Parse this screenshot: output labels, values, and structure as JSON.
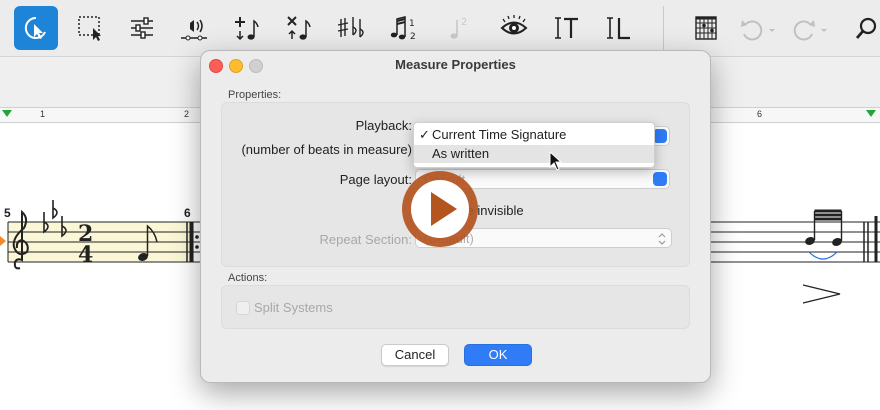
{
  "toolbar": {
    "tools": [
      {
        "name": "selection-arrow-icon"
      },
      {
        "name": "select-region-icon"
      },
      {
        "name": "mixer-sliders-icon"
      },
      {
        "name": "playback-speaker-icon"
      },
      {
        "name": "add-note-icon"
      },
      {
        "name": "delete-note-icon"
      },
      {
        "name": "accidentals-icon"
      },
      {
        "name": "tuplet-notes-icon",
        "sub": "1",
        "sub2": "2"
      },
      {
        "name": "voice-two-icon",
        "sub": "2"
      },
      {
        "name": "view-eye-icon"
      },
      {
        "name": "text-cursor-icon"
      },
      {
        "name": "lyrics-cursor-icon"
      },
      {
        "name": "chord-grid-icon"
      },
      {
        "name": "undo-icon"
      },
      {
        "name": "redo-icon"
      },
      {
        "name": "search-icon"
      }
    ]
  },
  "ruler": {
    "numbers": [
      "1",
      "2",
      "6"
    ]
  },
  "score": {
    "measure_numbers": [
      "5",
      "6"
    ],
    "time_signature": {
      "top": "2",
      "bottom": "4"
    }
  },
  "dialog": {
    "title": "Measure Properties",
    "properties_label": "Properties:",
    "playback_label": "Playback:",
    "beats_label": "(number of beats in measure)",
    "page_layout_label": "Page layout:",
    "page_layout_value": "Default",
    "make_invisible_label": "Make invisible",
    "repeat_section_label": "Repeat Section:",
    "repeat_section_value": "(Default)",
    "actions_label": "Actions:",
    "split_systems_label": "Split Systems",
    "cancel_label": "Cancel",
    "ok_label": "OK",
    "accent_color": "#2f7cf6"
  },
  "menu": {
    "items": [
      {
        "label": "Current Time Signature",
        "checked": true
      },
      {
        "label": "As written",
        "checked": false
      }
    ]
  },
  "overlay": {
    "color": "#b4541f"
  }
}
